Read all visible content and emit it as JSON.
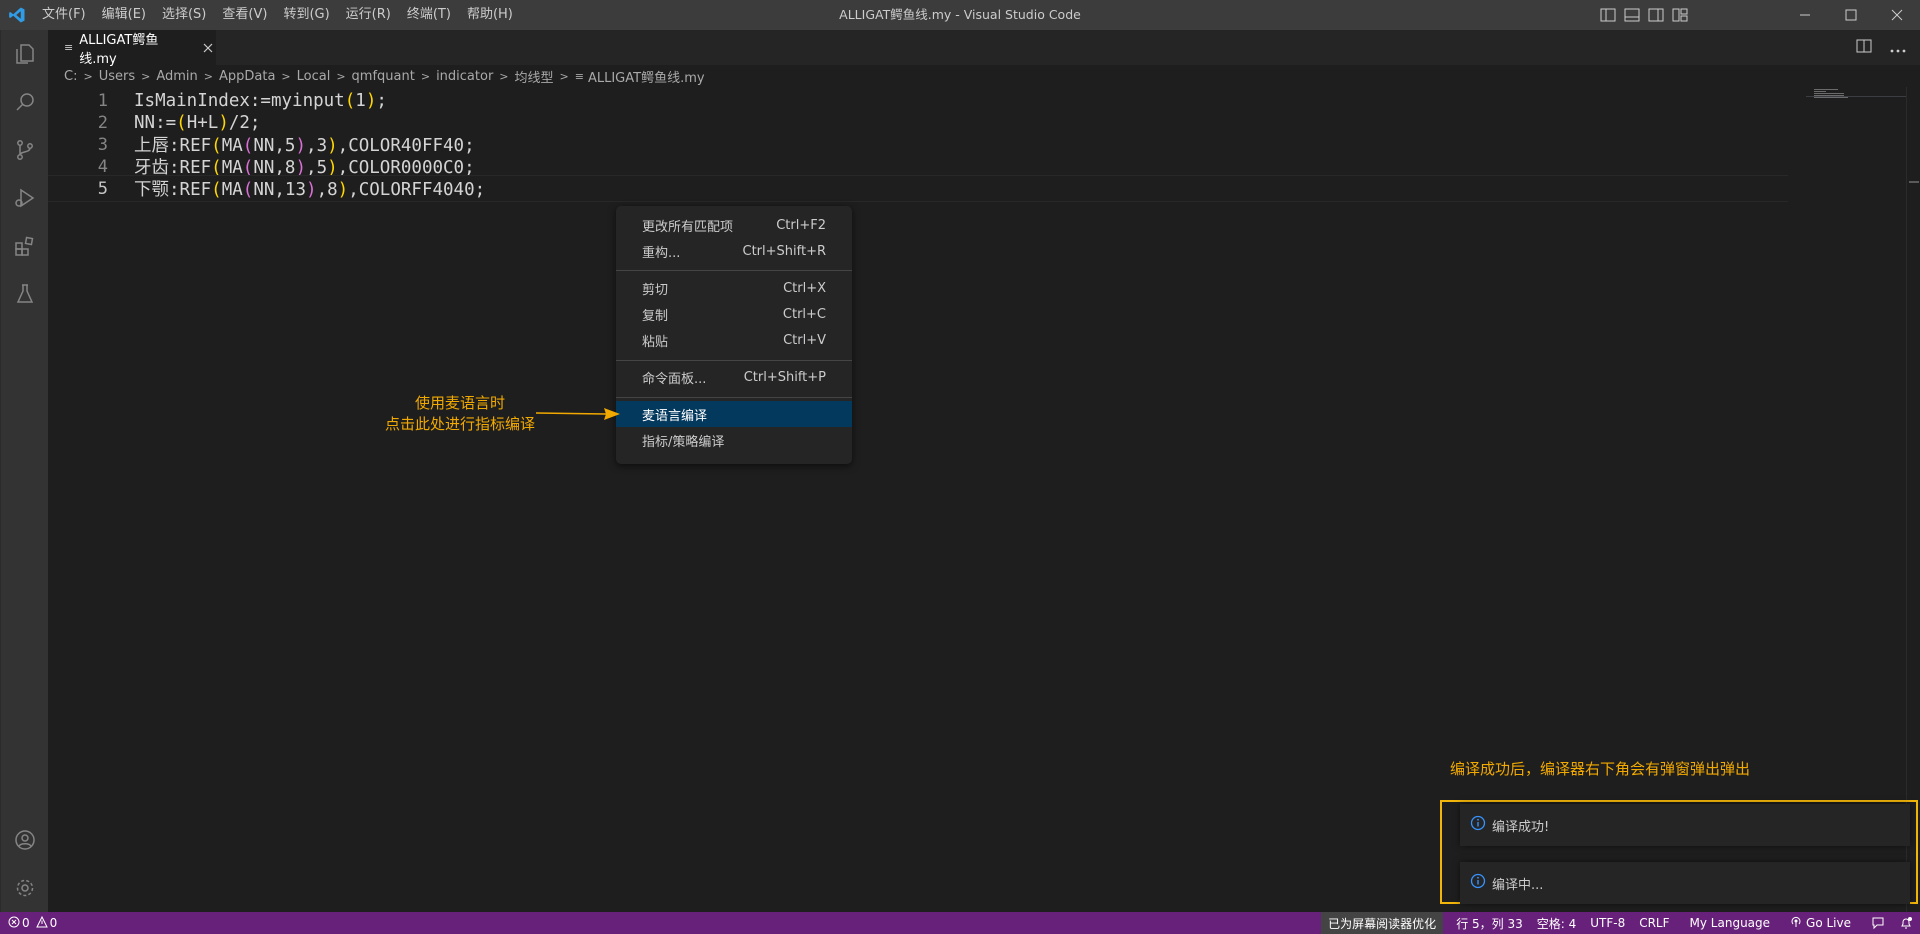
{
  "window": {
    "title": "ALLIGAT鳄鱼线.my - Visual Studio Code",
    "menu": [
      "文件(F)",
      "编辑(E)",
      "选择(S)",
      "查看(V)",
      "转到(G)",
      "运行(R)",
      "终端(T)",
      "帮助(H)"
    ]
  },
  "activity_bar": {
    "icons": [
      "explorer-icon",
      "search-icon",
      "source-control-icon",
      "run-debug-icon",
      "extensions-icon",
      "testing-icon",
      "account-icon",
      "manage-gear-icon"
    ]
  },
  "tab": {
    "label": "ALLIGAT鳄鱼线.my",
    "file_icon": "≡"
  },
  "breadcrumb": [
    "C:",
    "Users",
    "Admin",
    "AppData",
    "Local",
    "qmfquant",
    "indicator",
    "均线型",
    "ALLIGAT鳄鱼线.my"
  ],
  "editor": {
    "lines": [
      {
        "num": "1",
        "parts": [
          [
            "t",
            "IsMainIndex:=myinput"
          ],
          [
            "b1",
            "("
          ],
          [
            "t",
            "1"
          ],
          [
            "b1",
            ")"
          ],
          [
            "t",
            ";"
          ]
        ]
      },
      {
        "num": "2",
        "parts": [
          [
            "t",
            "NN:="
          ],
          [
            "b1",
            "("
          ],
          [
            "t",
            "H+L"
          ],
          [
            "b1",
            ")"
          ],
          [
            "t",
            "/2;"
          ]
        ]
      },
      {
        "num": "3",
        "parts": [
          [
            "t",
            "上唇:REF"
          ],
          [
            "b1",
            "("
          ],
          [
            "t",
            "MA"
          ],
          [
            "b2",
            "("
          ],
          [
            "t",
            "NN,5"
          ],
          [
            "b2",
            ")"
          ],
          [
            "t",
            ",3"
          ],
          [
            "b1",
            ")"
          ],
          [
            "t",
            ",COLOR40FF40;"
          ]
        ]
      },
      {
        "num": "4",
        "parts": [
          [
            "t",
            "牙齿:REF"
          ],
          [
            "b1",
            "("
          ],
          [
            "t",
            "MA"
          ],
          [
            "b2",
            "("
          ],
          [
            "t",
            "NN,8"
          ],
          [
            "b2",
            ")"
          ],
          [
            "t",
            ",5"
          ],
          [
            "b1",
            ")"
          ],
          [
            "t",
            ",COLOR0000C0;"
          ]
        ]
      },
      {
        "num": "5",
        "parts": [
          [
            "t",
            "下颚:REF"
          ],
          [
            "b1",
            "("
          ],
          [
            "t",
            "MA"
          ],
          [
            "b2",
            "("
          ],
          [
            "t",
            "NN,13"
          ],
          [
            "b2",
            ")"
          ],
          [
            "t",
            ",8"
          ],
          [
            "b1",
            ")"
          ],
          [
            "t",
            ",COLORFF4040;"
          ]
        ]
      }
    ],
    "active_line": 5
  },
  "context_menu": {
    "items": [
      {
        "label": "更改所有匹配项",
        "shortcut": "Ctrl+F2"
      },
      {
        "label": "重构...",
        "shortcut": "Ctrl+Shift+R"
      },
      {
        "label": "剪切",
        "shortcut": "Ctrl+X"
      },
      {
        "label": "复制",
        "shortcut": "Ctrl+C"
      },
      {
        "label": "粘贴",
        "shortcut": "Ctrl+V"
      },
      {
        "label": "命令面板...",
        "shortcut": "Ctrl+Shift+P"
      },
      {
        "label": "麦语言编译",
        "shortcut": ""
      },
      {
        "label": "指标/策略编译",
        "shortcut": ""
      }
    ],
    "selected": "麦语言编译"
  },
  "annotations": {
    "arrow_note_line1": "使用麦语言时",
    "arrow_note_line2": "点击此处进行指标编译",
    "notif_note": "编译成功后，编译器右下角会有弹窗弹出弹出",
    "color": "#f2a900"
  },
  "notifications": [
    {
      "text": "编译成功!",
      "icon": "info-icon"
    },
    {
      "text": "编译中...",
      "icon": "info-icon"
    }
  ],
  "statusbar": {
    "errors": "0",
    "warnings": "0",
    "screen_reader": "已为屏幕阅读器优化",
    "position": "行 5，列 33",
    "spaces": "空格: 4",
    "encoding": "UTF-8",
    "eol": "CRLF",
    "language": "My Language",
    "golive": "Go Live",
    "color": "#68217a"
  }
}
